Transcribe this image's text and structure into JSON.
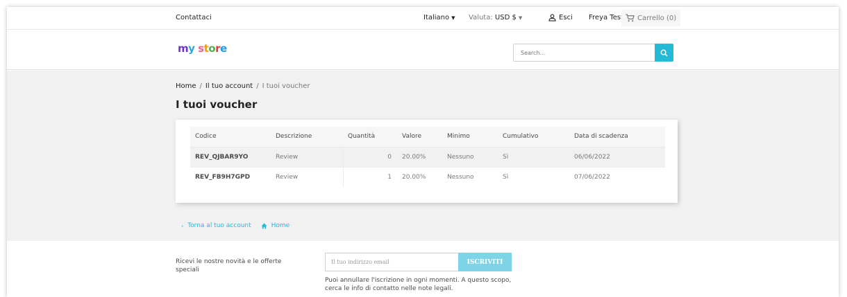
{
  "topbar": {
    "contact": "Contattaci",
    "language": "Italiano",
    "currency_label": "Valuta:",
    "currency_value": "USD $",
    "logout": "Esci",
    "user_name": "Freya Test",
    "cart": "Carrello (0)"
  },
  "header": {
    "logo": {
      "m": "m",
      "y": "y",
      "s": "s",
      "t": "t",
      "o": "o",
      "r": "r",
      "e": "e"
    },
    "search_placeholder": "Search..."
  },
  "main": {
    "breadcrumb": [
      "Home",
      "Il tuo account",
      "I tuoi voucher"
    ],
    "title": "I tuoi voucher",
    "table": {
      "headers": [
        "Codice",
        "Descrizione",
        "Quantità",
        "Valore",
        "Minimo",
        "Cumulativo",
        "Data di scadenza"
      ],
      "rows": [
        [
          "REV_QJBAR9YO",
          "Review",
          "0",
          "20.00%",
          "Nessuno",
          "Sì",
          "06/06/2022"
        ],
        [
          "REV_FB9H7GPD",
          "Review",
          "1",
          "20.00%",
          "Nessuno",
          "Sì",
          "07/06/2022"
        ]
      ]
    },
    "links": {
      "back": "Torna al tuo account",
      "home": "Home"
    }
  },
  "newsletter": {
    "text": "Ricevi le nostre novità e le offerte speciali",
    "input_placeholder": "Il tuo indirizzo email",
    "button": "ISCRIVITI",
    "note": "Puoi annullare l'iscrizione in ogni momenti. A questo scopo, cerca le info di contatto nelle note legali."
  },
  "colors": {
    "accent": "#24b9d7",
    "button_light": "#7fd3e6",
    "background_main": "#f1f1f1"
  }
}
